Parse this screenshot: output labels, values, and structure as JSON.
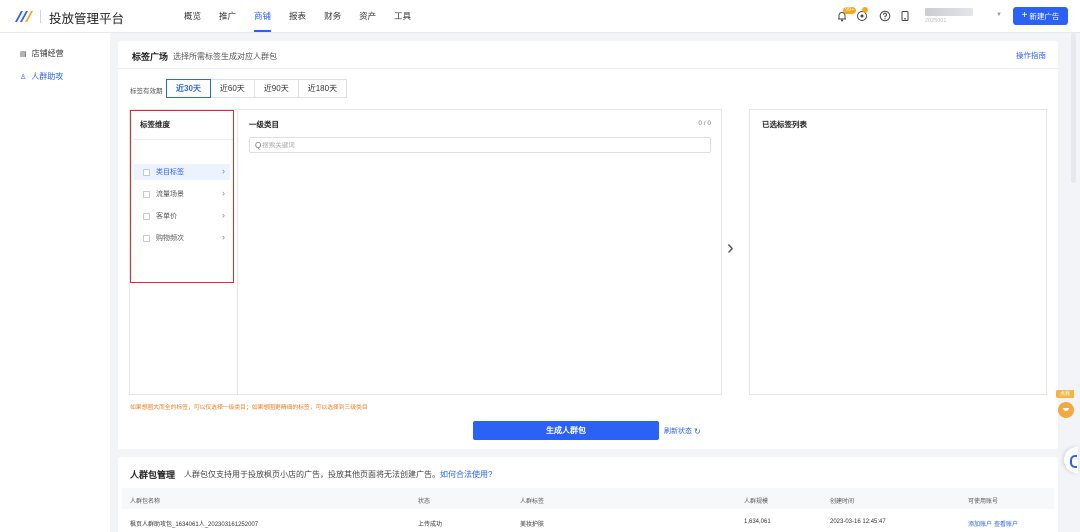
{
  "app": {
    "title": "投放管理平台"
  },
  "nav": {
    "items": [
      "概览",
      "推广",
      "商铺",
      "报表",
      "财务",
      "资产",
      "工具"
    ],
    "active_index": 2
  },
  "header": {
    "badge_count": "99+",
    "account_sub": "2025001",
    "new_ad_label": "新建广告"
  },
  "sidebar": {
    "items": [
      {
        "label": "店铺经营",
        "icon": "store-icon"
      },
      {
        "label": "人群助攻",
        "icon": "people-icon"
      }
    ],
    "active_index": 1
  },
  "tag_square": {
    "title": "标签广场",
    "subtitle": "选择所需标签生成对应人群包",
    "guide_link": "操作指南",
    "period_label": "标签有效期",
    "periods": [
      "近30天",
      "近60天",
      "近90天",
      "近180天"
    ],
    "active_period": 0,
    "dimension_header": "标签维度",
    "dimensions": [
      "类目标签",
      "流量场景",
      "客单价",
      "购物频次"
    ],
    "active_dimension": 0,
    "category_header": "一级类目",
    "category_count": "0 / 0",
    "search_placeholder": "搜索关键词",
    "search_value": "",
    "selected_header": "已选标签列表",
    "warning": "如果想圈大而全的标签，可以仅选择一级类目；如果想圈更精细的标签，可以选择到三级类目",
    "generate_label": "生成人群包",
    "refresh_label": "刷新状态"
  },
  "crowd_mgmt": {
    "title": "人群包管理",
    "subtitle": "人群包仅支持用于投放枫页小店的广告，投放其他页面将无法创建广告。",
    "help_link": "如何合法使用?",
    "columns": [
      "人群包名称",
      "状态",
      "人群标签",
      "人群规模",
      "创建时间",
      "可使用账号"
    ],
    "rows": [
      {
        "name": "枫页人群助攻包_1634061人_202303161252007",
        "status": "上传成功",
        "tag": "美妆护肤",
        "size": "1,634,061",
        "created": "2023-03-16 12:45:47",
        "action_add": "添加账户",
        "action_view": "查看账户"
      }
    ]
  },
  "side_float": {
    "tab_label": "点我"
  },
  "colors": {
    "accent": "#2b62f5",
    "warning": "#f07b1f",
    "highlight": "#e12b2b",
    "badge": "#f7a81c"
  }
}
